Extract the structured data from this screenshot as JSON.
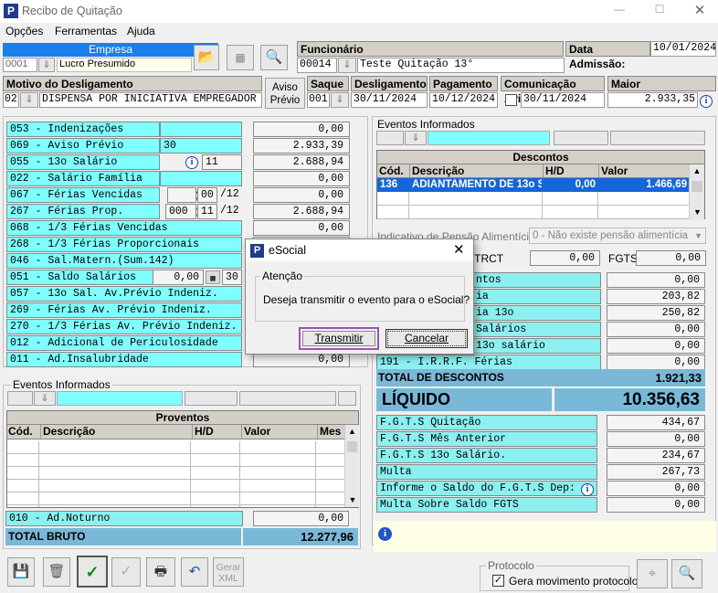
{
  "window": {
    "title": "Recibo de Quitação"
  },
  "menu": [
    "Opções",
    "Ferramentas",
    "Ajuda"
  ],
  "empresa": {
    "label": "Empresa",
    "code": "0001",
    "name": "Lucro Presumido"
  },
  "funcionario": {
    "label": "Funcionário",
    "code": "00014",
    "name": "Teste Quitação 13°"
  },
  "admissao": {
    "label": "Data Admissão:",
    "value": "10/01/2024"
  },
  "motivo": {
    "label": "Motivo do Desligamento",
    "code": "02",
    "text": "DISPENSA POR INICIATIVA EMPREGADOR"
  },
  "aviso_previo_label_1": "Aviso",
  "aviso_previo_label_2": "Prévio",
  "saque": {
    "label": "Saque",
    "value": "001"
  },
  "desligamento": {
    "label": "Desligamento",
    "value": "30/11/2024"
  },
  "pagamento": {
    "label": "Pagamento",
    "value": "10/12/2024"
  },
  "comunicacao": {
    "label": "Comunicação Aviso",
    "value": "30/11/2024"
  },
  "maior_remuneracao": {
    "label": "Maior Remuneração",
    "value": "2.933,35"
  },
  "rubricas": [
    {
      "label": "053 - Indenizações",
      "extra": "",
      "value": "0,00"
    },
    {
      "label": "069 - Aviso Prévio",
      "extra": "30",
      "value": "2.933,39"
    },
    {
      "label": "055 - 13o Salário",
      "extra": "11",
      "value": "2.688,94"
    },
    {
      "label": "022 - Salário Família",
      "extra": "",
      "value": "0,00"
    },
    {
      "label": "067 - Férias Vencidas",
      "extra": "00",
      "extra2": "/12",
      "value": "0,00"
    },
    {
      "label": "267 - Férias Prop.",
      "extra0": "000",
      "extra": "11",
      "extra2": "/12",
      "value": "2.688,94"
    },
    {
      "label": "068 - 1/3 Férias Vencidas",
      "extra": "",
      "value": "0,00"
    },
    {
      "label": "268 - 1/3 Férias Proporcionais",
      "extra": "",
      "value": "0,00"
    },
    {
      "label": "046 - Sal.Matern.(Sum.142)",
      "extra": "",
      "value": "0,00"
    },
    {
      "label": "051 - Saldo Salários",
      "extra0": "0,00",
      "extra": "30",
      "value": "0,00"
    },
    {
      "label": "057 - 13o Sal. Av.Prévio Indeniz.",
      "extra": "",
      "value": "0,00"
    },
    {
      "label": "269 - Férias  Av. Prévio Indeniz.",
      "extra": "",
      "value": "0,00"
    },
    {
      "label": "270 - 1/3 Férias Av. Prévio Indeniz.",
      "extra": "",
      "value": "0,00"
    },
    {
      "label": "012 - Adicional de Periculosidade",
      "extra": "",
      "value": "0,00"
    },
    {
      "label": "011 - Ad.Insalubridade",
      "extra": "",
      "value": "0,00"
    }
  ],
  "eventos_left": {
    "label": "Eventos Informados"
  },
  "proventos": {
    "title": "Proventos",
    "columns": [
      "Cód.",
      "Descrição",
      "H/D",
      "Valor",
      "Mes"
    ]
  },
  "ad_noturno": {
    "label": "010 - Ad.Noturno",
    "value": "0,00"
  },
  "total_bruto": {
    "label": "TOTAL BRUTO",
    "value": "12.277,96"
  },
  "eventos_right": {
    "label": "Eventos Informados"
  },
  "descontos": {
    "title": "Descontos",
    "columns": [
      "Cód.",
      "Descrição",
      "H/D",
      "Valor"
    ],
    "rows": [
      {
        "cod": "136",
        "desc": "ADIANTAMENTO DE 13o S/",
        "hd": "0,00",
        "valor": "1.466,69"
      }
    ]
  },
  "pensao": {
    "label": "Indicativo de Pensão Alimentícia",
    "value": "0 - Não existe pensão alimentícia"
  },
  "trct": {
    "label": "- TRCT",
    "value": "0,00",
    "fgts_label": "FGTS",
    "fgts_value": "0,00"
  },
  "desc_rows": [
    {
      "label": "ntos",
      "value": "0,00"
    },
    {
      "label": "ia",
      "value": "203,82"
    },
    {
      "label": "ia 13o",
      "value": "250,82"
    },
    {
      "label": "Salários",
      "value": "0,00"
    },
    {
      "label": "13o salário",
      "value": "0,00"
    },
    {
      "label": "191 - I.R.R.F. Férias",
      "value": "0,00"
    }
  ],
  "total_descontos": {
    "label": "TOTAL DE DESCONTOS",
    "value": "1.921,33"
  },
  "liquido": {
    "label": "LÍQUIDO",
    "value": "10.356,63"
  },
  "fgts_rows": [
    {
      "label": "F.G.T.S  Quitação",
      "value": "434,67"
    },
    {
      "label": "F.G.T.S  Mês Anterior",
      "value": "0,00"
    },
    {
      "label": "F.G.T.S  13o Salário.",
      "value": "234,67"
    },
    {
      "label": "Multa",
      "value": "267,73"
    },
    {
      "label": "Informe o Saldo do F.G.T.S Dep:",
      "value": "0,00"
    },
    {
      "label": "Multa Sobre Saldo FGTS",
      "value": "0,00"
    }
  ],
  "protocolo": {
    "title": "Protocolo",
    "checkbox_label": "Gera movimento protocolo",
    "checked": true
  },
  "toolbar": {
    "gerar_xml_1": "Gerar",
    "gerar_xml_2": "XML"
  },
  "dialog": {
    "title": "eSocial",
    "group": "Atenção",
    "message": "Deseja transmitir o evento para o eSocial?",
    "primary": "Transmitir",
    "secondary": "Cancelar"
  }
}
